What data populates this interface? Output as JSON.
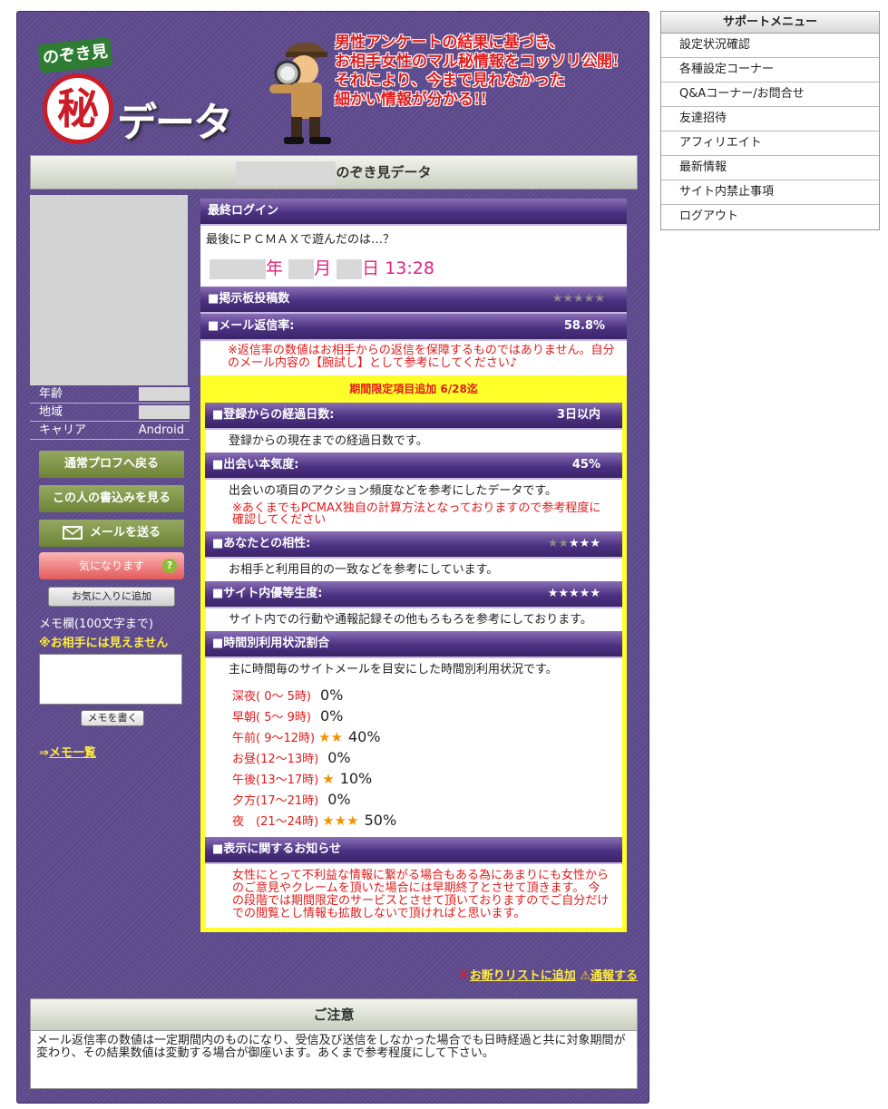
{
  "header": {
    "logo_badge": "のぞき見",
    "logo_kanji": "秘",
    "logo_data": "データ",
    "tagline": [
      "男性アンケートの結果に基づき、",
      "お相手女性のマル秘情報をコッソリ公開!",
      "それにより、今まで見れなかった",
      "細かい情報が分かる!!"
    ]
  },
  "title_suffix": "のぞき見データ",
  "profile": {
    "rows": [
      {
        "label": "年齢",
        "value": ""
      },
      {
        "label": "地域",
        "value": ""
      },
      {
        "label": "キャリア",
        "value": "Android"
      }
    ],
    "btn_profile": "通常プロフへ戻る",
    "btn_posts": "この人の書込みを見る",
    "btn_mail": "メールを送る",
    "btn_interest": "気になります",
    "btn_favorite": "お気に入りに追加",
    "memo_label": "メモ欄(100文字まで)",
    "memo_note": "※お相手には見えません",
    "memo_button": "メモを書く",
    "memo_link_arrow": "⇒",
    "memo_link": "メモ一覧"
  },
  "last_login": {
    "heading": "最終ログイン",
    "caption": "最後にＰＣＭＡＸで遊んだのは…？",
    "year_unit": "年",
    "month_unit": "月",
    "day_unit": "日",
    "time": "13:28"
  },
  "board_posts": {
    "heading": "■掲示板投稿数",
    "stars": "★★★★★"
  },
  "mail_reply": {
    "heading": "■メール返信率:",
    "value": "58.8%",
    "warning": "※返信率の数値はお相手からの返信を保障するものではありません。自分のメール内容の【腕試し】として参考にしてください♪"
  },
  "limited": {
    "banner": "期間限定項目追加 6/28迄",
    "elapsed": {
      "heading": "■登録からの経過日数:",
      "value": "3日以内",
      "desc": "登録からの現在までの経過日数です。"
    },
    "serious": {
      "heading": "■出会い本気度:",
      "value": "45%",
      "desc": "出会いの項目のアクション頻度などを参考にしたデータです。",
      "warning": "※あくまでもPCMAX独自の計算方法となっておりますので参考程度に確認してください"
    },
    "compat": {
      "heading": "■あなたとの相性:",
      "stars_off": "★★",
      "stars_on": "★★★",
      "desc": "お相手と利用目的の一致などを参考にしています。"
    },
    "priority": {
      "heading": "■サイト内優等生度:",
      "stars": "★★★★★",
      "desc": "サイト内での行動や通報記録その他もろもろを参考にしております。"
    },
    "hourly": {
      "heading": "■時間別利用状況割合",
      "desc": "主に時間毎のサイトメールを目安にした時間別利用状況です。",
      "rows": [
        {
          "label": "深夜( 0～ 5時)",
          "stars": "",
          "pct": "0%"
        },
        {
          "label": "早朝( 5～ 9時)",
          "stars": "",
          "pct": "0%"
        },
        {
          "label": "午前( 9～12時)",
          "stars": "★★",
          "pct": "40%"
        },
        {
          "label": "お昼(12～13時)",
          "stars": "",
          "pct": "0%"
        },
        {
          "label": "午後(13～17時)",
          "stars": "★",
          "pct": "10%"
        },
        {
          "label": "夕方(17～21時)",
          "stars": "",
          "pct": "0%"
        },
        {
          "label": "夜　(21～24時)",
          "stars": "★★★",
          "pct": "50%"
        }
      ]
    },
    "notice": {
      "heading": "■表示に関するお知らせ",
      "text": "女性にとって不利益な情報に繋がる場合もある為にあまりにも女性からのご意見やクレームを頂いた場合には早期終了とさせて頂きます。 今の段階では期間限定のサービスとさせて頂いておりますのでご自分だけでの閲覧とし情報も拡散しないで頂ければと思います。"
    }
  },
  "links": {
    "refuse": "お断りリストに追加",
    "report": "通報する"
  },
  "caution": {
    "title": "ご注意",
    "text": "メール返信率の数値は一定期間内のものになり、受信及び送信をしなかった場合でも日時経過と共に対象期間が変わり、その結果数値は変動する場合が御座います。あくまで参考程度にして下さい。"
  },
  "support_menu": {
    "title": "サポートメニュー",
    "items": [
      "設定状況確認",
      "各種設定コーナー",
      "Q&Aコーナー/お問合せ",
      "友達招待",
      "アフィリエイト",
      "最新情報",
      "サイト内禁止事項",
      "ログアウト"
    ]
  },
  "colors": {
    "panel": "#5d4a8e",
    "accent_pink": "#e0237d",
    "warning_red": "#e21b1b",
    "highlight_yellow": "#ffff2a",
    "button_green": "#6d8436"
  }
}
